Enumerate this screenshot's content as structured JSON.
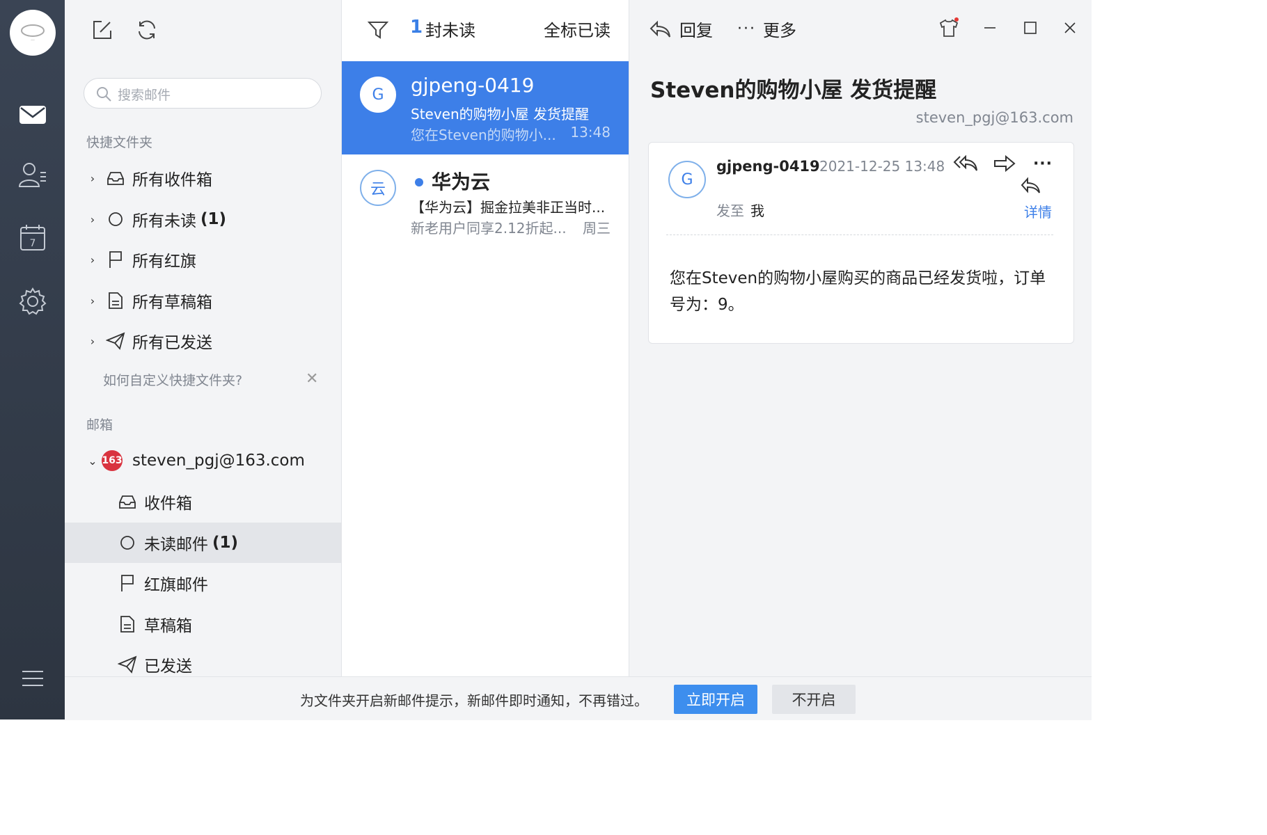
{
  "sidebar_rail": {
    "icons": [
      "avatar-logo",
      "mail-icon",
      "contacts-icon",
      "calendar-icon",
      "settings-icon",
      "menu-icon"
    ],
    "calendar_day": "7"
  },
  "folders": {
    "search_placeholder": "搜索邮件",
    "quick_title": "快捷文件夹",
    "quick_items": [
      {
        "label": "所有收件箱",
        "count": ""
      },
      {
        "label": "所有未读",
        "count": "(1)"
      },
      {
        "label": "所有红旗",
        "count": ""
      },
      {
        "label": "所有草稿箱",
        "count": ""
      },
      {
        "label": "所有已发送",
        "count": ""
      }
    ],
    "tip": "如何自定义快捷文件夹?",
    "mailbox_title": "邮箱",
    "account": "steven_pgj@163.com",
    "account_badge": "163",
    "account_items": [
      {
        "label": "收件箱",
        "count": ""
      },
      {
        "label": "未读邮件",
        "count": "(1)"
      },
      {
        "label": "红旗邮件",
        "count": ""
      },
      {
        "label": "草稿箱",
        "count": ""
      },
      {
        "label": "已发送",
        "count": ""
      }
    ]
  },
  "list": {
    "unread_count": "1",
    "unread_label": "封未读",
    "mark_all": "全标已读",
    "items": [
      {
        "avatar": "G",
        "from": "gjpeng-0419",
        "subject": "Steven的购物小屋 发货提醒",
        "preview": "您在Steven的购物小...",
        "time": "13:48"
      },
      {
        "avatar": "云",
        "from": "华为云",
        "subject": "【华为云】掘金拉美非正当时...",
        "preview": "新老用户同享2.12折起...",
        "time": "周三"
      }
    ]
  },
  "reader": {
    "reply": "回复",
    "more": "更多",
    "subject": "Steven的购物小屋 发货提醒",
    "account": "steven_pgj@163.com",
    "avatar": "G",
    "from": "gjpeng-0419",
    "date": "2021-12-25 13:48",
    "to_label": "发至",
    "to": "我",
    "detail": "详情",
    "body": "您在Steven的购物小屋购买的商品已经发货啦，订单号为：9。"
  },
  "banner": {
    "message": "为文件夹开启新邮件提示，新邮件即时通知，不再错过。",
    "enable": "立即开启",
    "disable": "不开启"
  },
  "colors": {
    "accent": "#3d7fe8",
    "rail": "#323b48",
    "badge": "#d9333f"
  }
}
